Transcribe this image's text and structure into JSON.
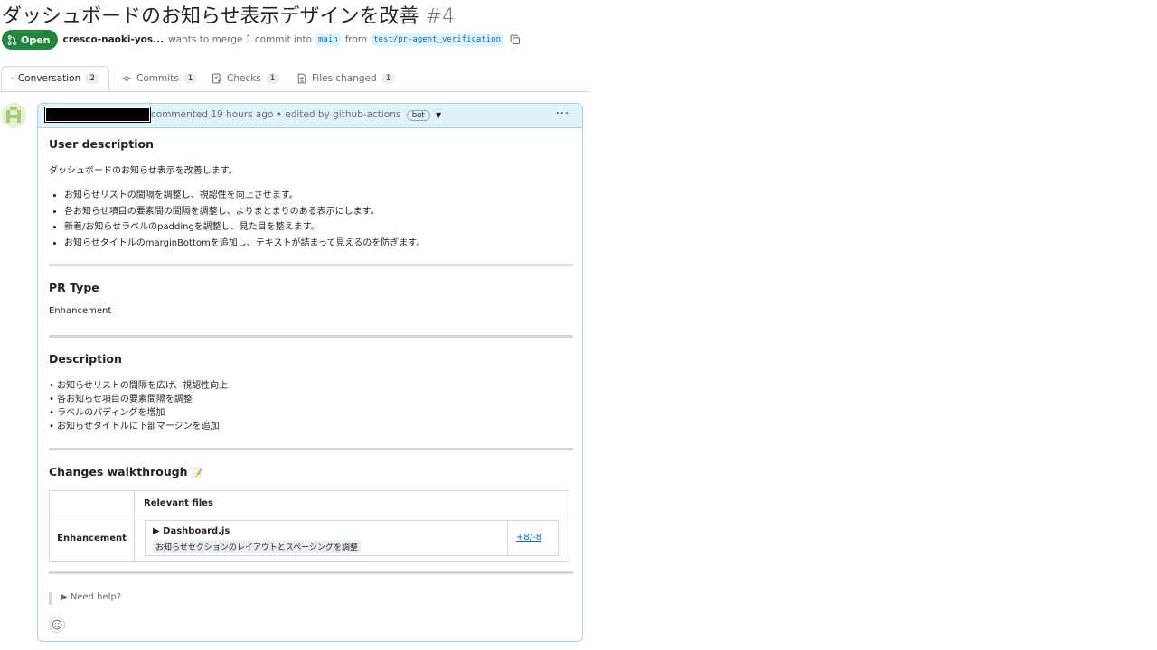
{
  "pr": {
    "title": "ダッシュボードのお知らせ表示デザインを改善",
    "number": "#4",
    "state": "Open",
    "author": "cresco-naoki-yos...",
    "merge_text": "wants to merge 1 commit into",
    "base_branch": "main",
    "from_text": "from",
    "head_branch": "test/pr-agent_verification"
  },
  "tabs": [
    {
      "label": "Conversation",
      "count": "2",
      "icon": "comment-discussion-icon"
    },
    {
      "label": "Commits",
      "count": "1",
      "icon": "git-commit-icon"
    },
    {
      "label": "Checks",
      "count": "1",
      "icon": "checklist-icon"
    },
    {
      "label": "Files changed",
      "count": "1",
      "icon": "file-diff-icon"
    }
  ],
  "comment": {
    "header_text": "commented 19 hours ago • edited by github-actions",
    "bot_badge": "bot",
    "menu": "···",
    "user_description": {
      "heading": "User description",
      "intro": "ダッシュボードのお知らせ表示を改善します。",
      "bullets": [
        "お知らせリストの間隔を調整し、視認性を向上させます。",
        "各お知らせ項目の要素間の間隔を調整し、よりまとまりのある表示にします。",
        "新着/お知らせラベルのpaddingを調整し、見た目を整えます。",
        "お知らせタイトルのmarginBottomを追加し、テキストが詰まって見えるのを防ぎます。"
      ]
    },
    "pr_type": {
      "heading": "PR Type",
      "value": "Enhancement"
    },
    "description": {
      "heading": "Description",
      "lines": [
        "• お知らせリストの間隔を広げ、視認性向上",
        "• 各お知らせ項目の要素間隔を調整",
        "• ラベルのパディングを増加",
        "• お知らせタイトルに下部マージンを追加"
      ]
    },
    "walkthrough": {
      "heading": "Changes walkthrough",
      "emoji": "📝",
      "column_header": "Relevant files",
      "row_label": "Enhancement",
      "file_name": "▶ Dashboard.js",
      "file_summary": "お知らせセクションのレイアウトとスペーシングを調整",
      "diff": "+8/-8"
    },
    "need_help": "▶ Need help?"
  },
  "colors": {
    "open_green": "#1f883d",
    "link_blue": "#0969da",
    "header_blue": "#ddf4ff"
  }
}
